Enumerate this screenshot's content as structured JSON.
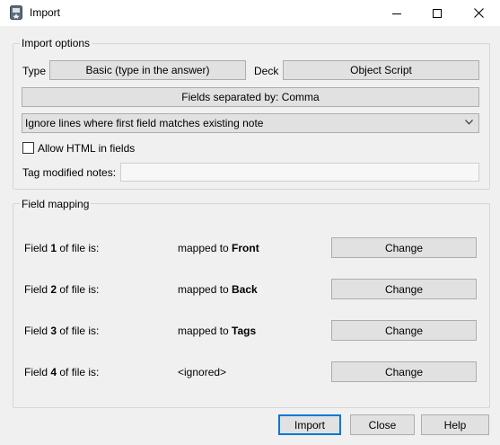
{
  "window": {
    "title": "Import"
  },
  "import_options": {
    "group_title": "Import options",
    "type_label": "Type",
    "type_value": "Basic (type in the answer)",
    "deck_label": "Deck",
    "deck_value": "Object Script",
    "fields_separated": "Fields separated by: Comma",
    "duplicate_mode": "Ignore lines where first field matches existing note",
    "allow_html_label": "Allow HTML in fields",
    "allow_html_checked": false,
    "tag_modified_label": "Tag modified notes:",
    "tag_modified_value": ""
  },
  "field_mapping": {
    "group_title": "Field mapping",
    "rows": [
      {
        "prefix": "Field ",
        "num": "1",
        "suffix": " of file is:",
        "map_prefix": "mapped to ",
        "map_target": "Front",
        "map_plain": "",
        "change_label": "Change"
      },
      {
        "prefix": "Field ",
        "num": "2",
        "suffix": " of file is:",
        "map_prefix": "mapped to ",
        "map_target": "Back",
        "map_plain": "",
        "change_label": "Change"
      },
      {
        "prefix": "Field ",
        "num": "3",
        "suffix": " of file is:",
        "map_prefix": "mapped to ",
        "map_target": "Tags",
        "map_plain": "",
        "change_label": "Change"
      },
      {
        "prefix": "Field ",
        "num": "4",
        "suffix": " of file is:",
        "map_prefix": "",
        "map_target": "",
        "map_plain": "<ignored>",
        "change_label": "Change"
      }
    ]
  },
  "footer": {
    "import_label": "Import",
    "close_label": "Close",
    "help_label": "Help"
  },
  "icons": {
    "app": "anki-app-icon",
    "minimize": "minimize-icon",
    "maximize": "maximize-icon",
    "close": "close-icon",
    "combo_arrow": "chevron-down-icon"
  }
}
